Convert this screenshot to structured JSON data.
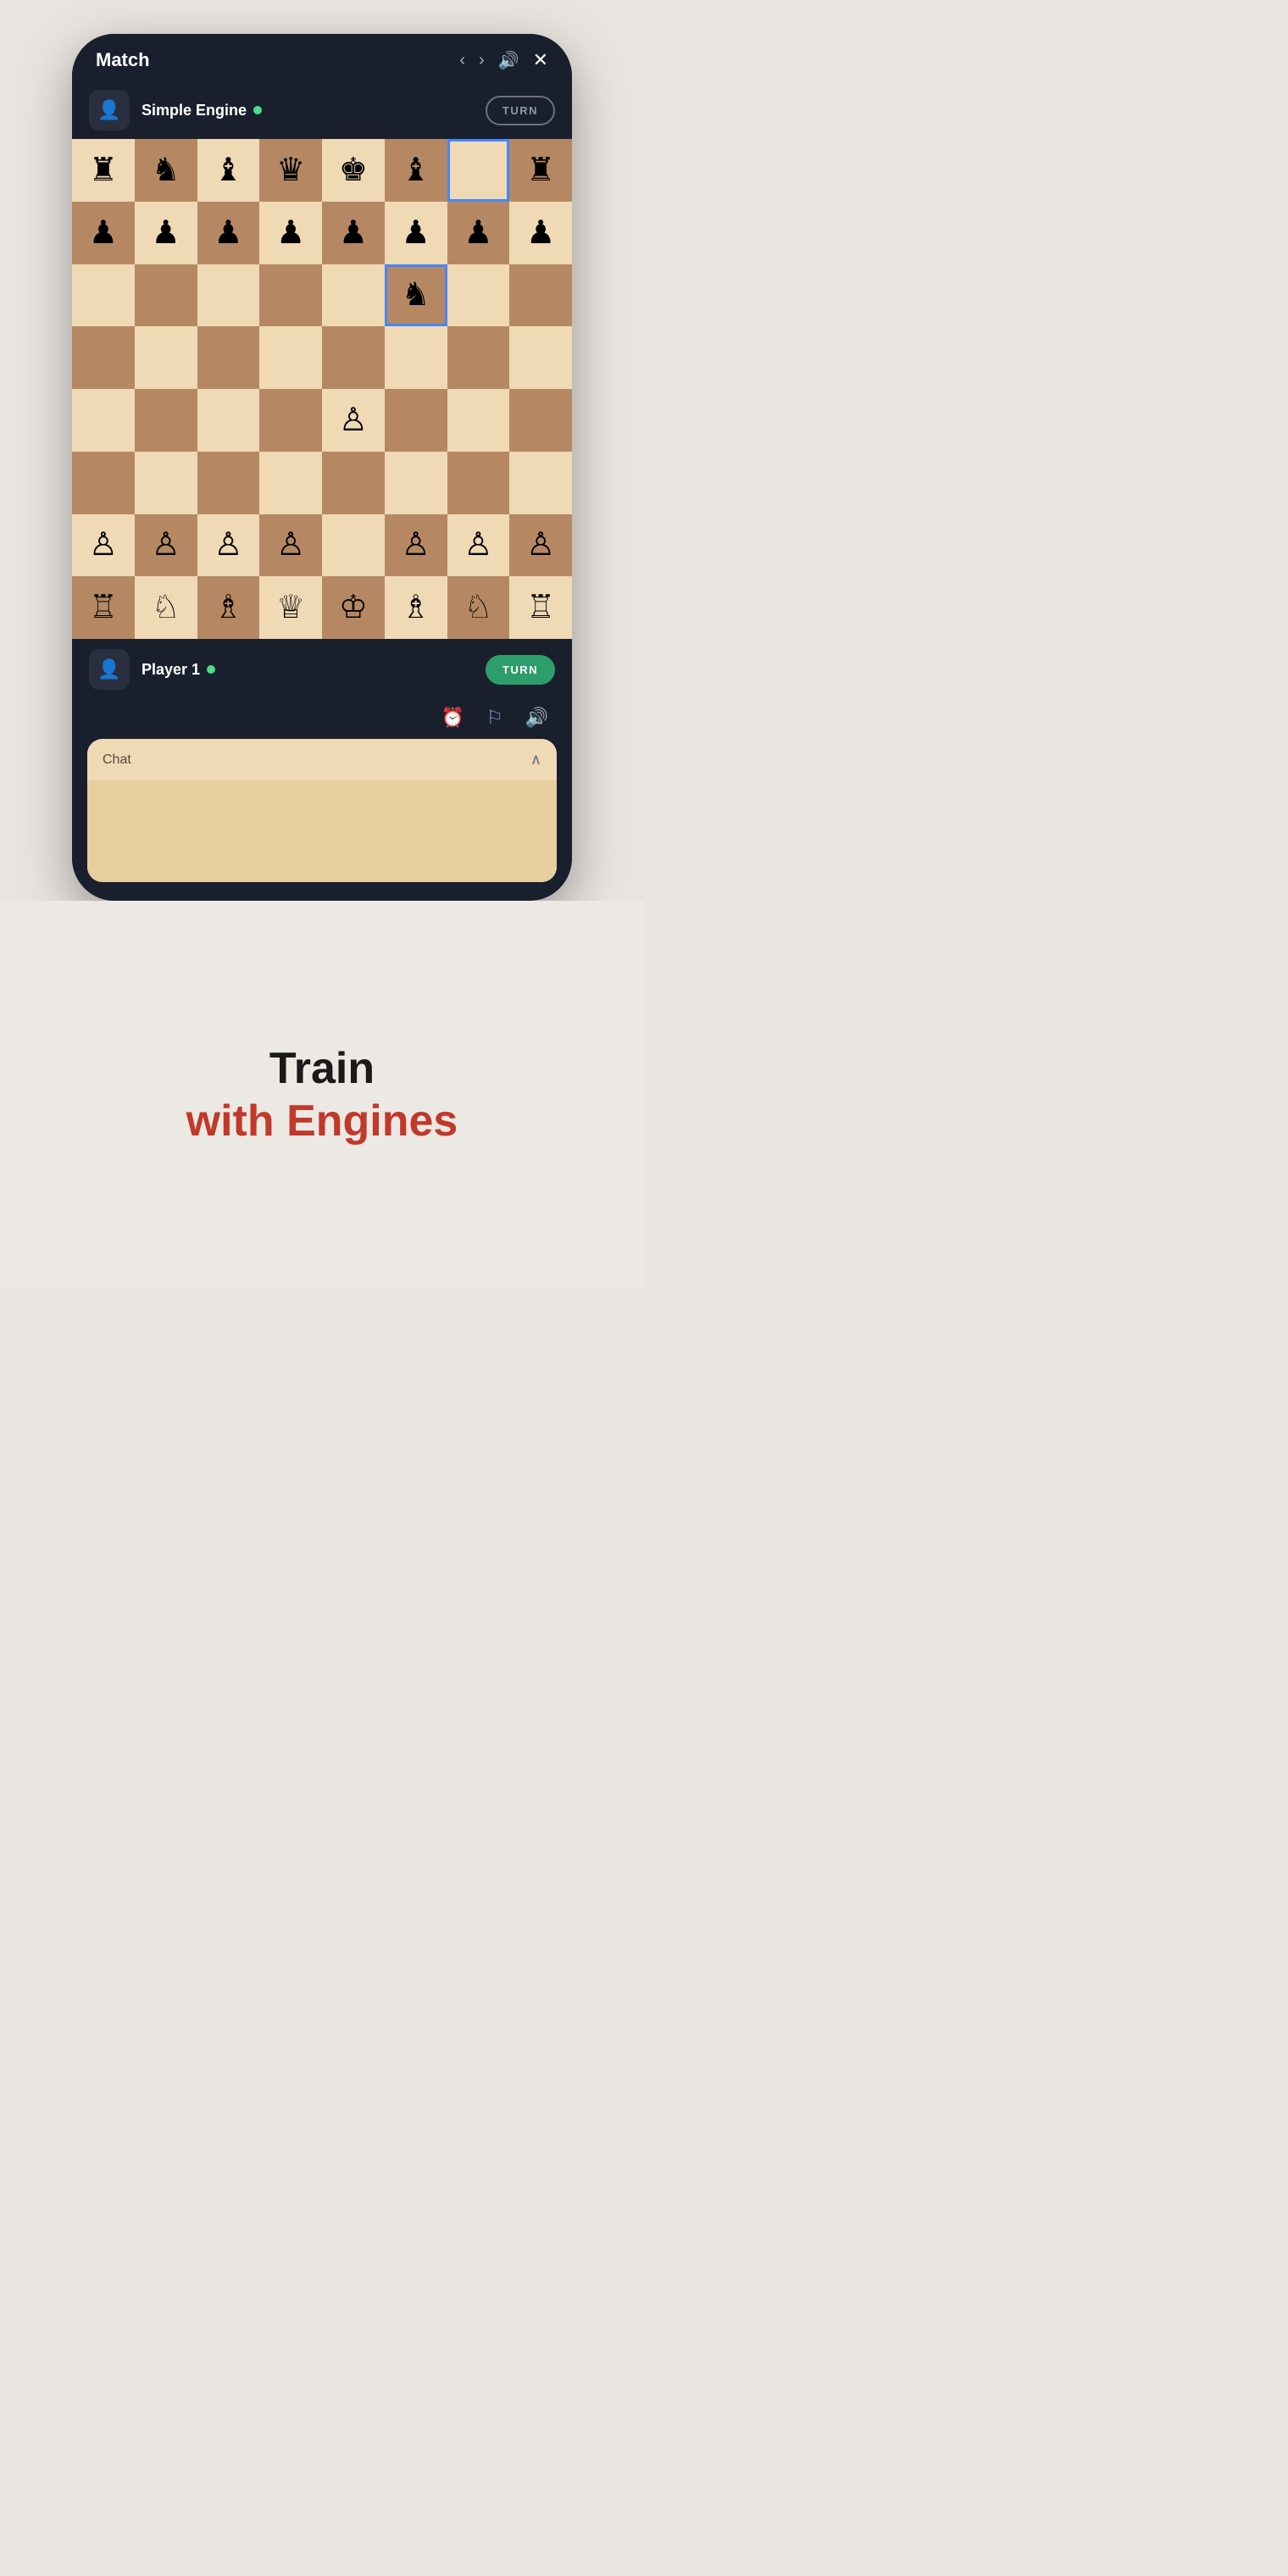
{
  "header": {
    "title": "Match",
    "back_icon": "‹",
    "forward_icon": "›",
    "sound_icon": "🔊",
    "close_icon": "✕"
  },
  "engine_player": {
    "name": "Simple Engine",
    "status": "online",
    "turn_label": "TURN",
    "turn_active": false
  },
  "human_player": {
    "name": "Player 1",
    "status": "online",
    "turn_label": "TURN",
    "turn_active": true
  },
  "chat": {
    "label": "Chat",
    "chevron": "∧",
    "placeholder": ""
  },
  "bottom": {
    "train_line1": "Train",
    "train_line2": "with Engines"
  },
  "board": {
    "rows": [
      [
        "♜",
        "♞",
        "♝",
        "♛",
        "♚",
        "♝",
        "_",
        "♜"
      ],
      [
        "♟",
        "♟",
        "♟",
        "♟",
        "♟",
        "♟",
        "♟",
        "♟"
      ],
      [
        "_",
        "_",
        "_",
        "_",
        "_",
        "♞",
        "_",
        "_"
      ],
      [
        "_",
        "_",
        "_",
        "_",
        "_",
        "_",
        "_",
        "_"
      ],
      [
        "_",
        "_",
        "_",
        "_",
        "♙",
        "_",
        "_",
        "_"
      ],
      [
        "_",
        "_",
        "_",
        "_",
        "_",
        "_",
        "_",
        "_"
      ],
      [
        "♙",
        "♙",
        "♙",
        "♙",
        "_",
        "♙",
        "♙",
        "♙"
      ],
      [
        "♖",
        "♘",
        "♗",
        "♕",
        "♔",
        "♗",
        "♘",
        "♖"
      ]
    ],
    "highlighted": [
      {
        "row": 0,
        "col": 6
      },
      {
        "row": 2,
        "col": 5
      }
    ]
  }
}
